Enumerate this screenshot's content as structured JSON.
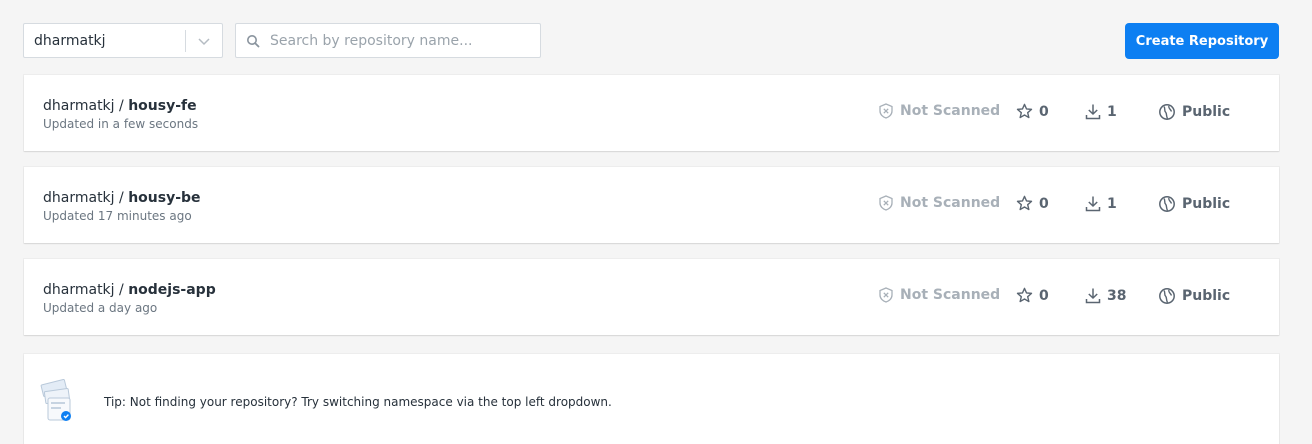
{
  "toolbar": {
    "namespace": "dharmatkj",
    "search_placeholder": "Search by repository name...",
    "create_button": "Create Repository"
  },
  "repositories": [
    {
      "namespace": "dharmatkj",
      "separator": " / ",
      "name": "housy-fe",
      "updated": "Updated in a few seconds",
      "scan_status": "Not Scanned",
      "stars": "0",
      "pulls": "1",
      "visibility": "Public"
    },
    {
      "namespace": "dharmatkj",
      "separator": " / ",
      "name": "housy-be",
      "updated": "Updated 17 minutes ago",
      "scan_status": "Not Scanned",
      "stars": "0",
      "pulls": "1",
      "visibility": "Public"
    },
    {
      "namespace": "dharmatkj",
      "separator": " / ",
      "name": "nodejs-app",
      "updated": "Updated a day ago",
      "scan_status": "Not Scanned",
      "stars": "0",
      "pulls": "38",
      "visibility": "Public"
    }
  ],
  "tip": {
    "text": "Tip: Not finding your repository? Try switching namespace via the top left dropdown."
  },
  "colors": {
    "accent": "#0d7ff2",
    "background": "#f5f5f5",
    "muted_text": "#6b7681",
    "scan_gray": "#a8b0b8"
  },
  "icons": {
    "chevron": "chevron-down-icon",
    "search": "search-icon",
    "scan": "shield-x-icon",
    "star": "star-icon",
    "pulls": "download-icon",
    "visibility": "globe-icon",
    "tip": "repository-illustration-icon"
  }
}
